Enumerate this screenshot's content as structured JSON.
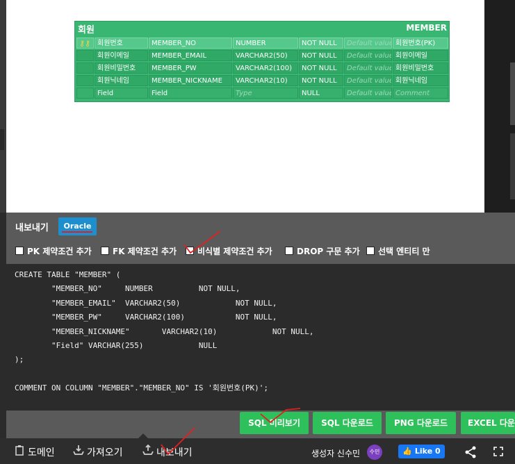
{
  "entity": {
    "logical_name": "회원",
    "physical_name": "MEMBER",
    "columns": [
      {
        "logical": "회원번호",
        "physical": "MEMBER_NO",
        "type": "NUMBER",
        "null": "NOT NULL",
        "default": "Default value",
        "comment": "회원번호(PK)",
        "pk": true
      },
      {
        "logical": "회원이메일",
        "physical": "MEMBER_EMAIL",
        "type": "VARCHAR2(50)",
        "null": "NOT NULL",
        "default": "Default value",
        "comment": "회원이메일",
        "pk": false
      },
      {
        "logical": "회원비밀번호",
        "physical": "MEMBER_PW",
        "type": "VARCHAR2(100)",
        "null": "NOT NULL",
        "default": "Default value",
        "comment": "회원비밀번호",
        "pk": false
      },
      {
        "logical": "회원닉네임",
        "physical": "MEMBER_NICKNAME",
        "type": "VARCHAR2(10)",
        "null": "NOT NULL",
        "default": "Default value",
        "comment": "회원닉네임",
        "pk": false
      },
      {
        "logical": "Field",
        "physical": "Field",
        "type": "Type",
        "null": "NULL",
        "default": "Default value",
        "comment": "Comment",
        "pk": false
      }
    ]
  },
  "export": {
    "title": "내보내기",
    "db_tab": "Oracle",
    "options": [
      "PK 제약조건 추가",
      "FK 제약조건 추가",
      "비식별 제약조건 추가",
      "DROP 구문 추가",
      "선택 엔티티 만"
    ],
    "sql": "CREATE TABLE \"MEMBER\" (\n\t\"MEMBER_NO\"\tNUMBER\t\tNOT NULL,\n\t\"MEMBER_EMAIL\"\tVARCHAR2(50)\t\tNOT NULL,\n\t\"MEMBER_PW\"\tVARCHAR2(100)\t\tNOT NULL,\n\t\"MEMBER_NICKNAME\"\tVARCHAR2(10)\t\tNOT NULL,\n\t\"Field\"\tVARCHAR(255)\t\tNULL\n);\n\nCOMMENT ON COLUMN \"MEMBER\".\"MEMBER_NO\" IS '회원번호(PK)';",
    "buttons": [
      "SQL 미리보기",
      "SQL 다운로드",
      "PNG 다운로드",
      "EXCEL 다운로드"
    ]
  },
  "footer": {
    "domain": "도메인",
    "import": "가져오기",
    "export": "내보내기",
    "creator": "생성자 신수민",
    "avatar": "수민",
    "like": "Like 0"
  },
  "colors": {
    "entity_green": "#39b672",
    "button_green": "#2ec05a",
    "oracle_blue": "#1e8fce",
    "panel_gray": "#5a5a5a",
    "code_bg": "#2b2b2b",
    "annotation_red": "#e02020"
  }
}
